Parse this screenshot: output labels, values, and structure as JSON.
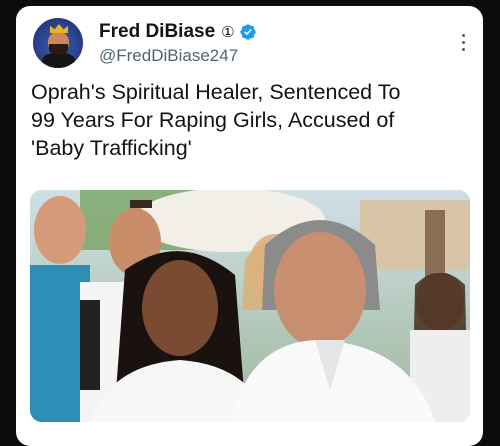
{
  "tweet": {
    "author": {
      "display_name": "Fred DiBiase",
      "badge_symbol": "①",
      "handle": "@FredDiBiase247",
      "verified": true,
      "avatar_icon": "crowned-man-avatar"
    },
    "text_lines": [
      "Oprah's Spiritual Healer, Sentenced To",
      "99 Years For Raping Girls, Accused of",
      "'Baby Trafficking'"
    ],
    "more_icon": "more-vertical-icon",
    "media": {
      "kind": "photo",
      "icon": "photo-of-people-group"
    }
  },
  "colors": {
    "background": "#0c0c0c",
    "card": "#ffffff",
    "text_primary": "#0f1419",
    "text_secondary": "#536471",
    "verified_blue": "#1d9bf0"
  }
}
